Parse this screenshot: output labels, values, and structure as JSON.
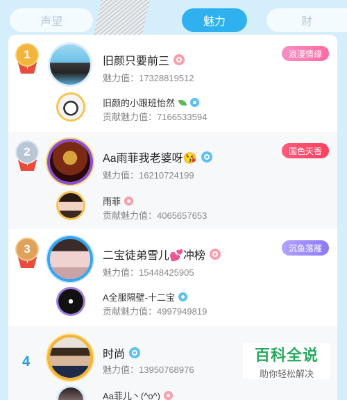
{
  "tabs": [
    {
      "label": "声望",
      "active": false
    },
    {
      "label": "魅力",
      "active": true
    },
    {
      "label": "财",
      "active": false
    }
  ],
  "colors": {
    "accent": "#2fb1f0",
    "rank_blue": "#1d9ce3",
    "female": "#f6a0ad",
    "male": "#5cc0f4"
  },
  "entries": [
    {
      "rank": "1",
      "name": "旧颜只要前三",
      "gender": "female",
      "charm_label": "魅力值：",
      "charm_value": "17328819512",
      "badge": "浪漫情缘",
      "contributor": {
        "name": "旧颜的小跟班怡然",
        "gender": "male",
        "label": "贡献魅力值：",
        "value": "7166533594"
      }
    },
    {
      "rank": "2",
      "name": "Aa雨菲我老婆呀😘",
      "gender": "male",
      "charm_label": "魅力值：",
      "charm_value": "16210724199",
      "badge": "国色天香",
      "contributor": {
        "name": "雨菲",
        "gender": "female",
        "label": "贡献魅力值：",
        "value": "4065657653"
      }
    },
    {
      "rank": "3",
      "name": "二宝徒弟雪儿💕冲榜",
      "gender": "female",
      "charm_label": "魅力值：",
      "charm_value": "15448425905",
      "badge": "沉鱼落雁",
      "contributor": {
        "name": "A全服隔壁-十二宝",
        "gender": "male",
        "label": "贡献魅力值：",
        "value": "4997949819"
      }
    },
    {
      "rank": "4",
      "name": "时尚",
      "gender": "male",
      "charm_label": "魅力值：",
      "charm_value": "13950768976",
      "badge": "",
      "contributor": {
        "name": "Aa菲儿丶(^o^)",
        "gender": "female",
        "label": "",
        "value": ""
      }
    }
  ],
  "watermark": {
    "title": "百科全说",
    "subtitle": "助你轻松解决"
  }
}
